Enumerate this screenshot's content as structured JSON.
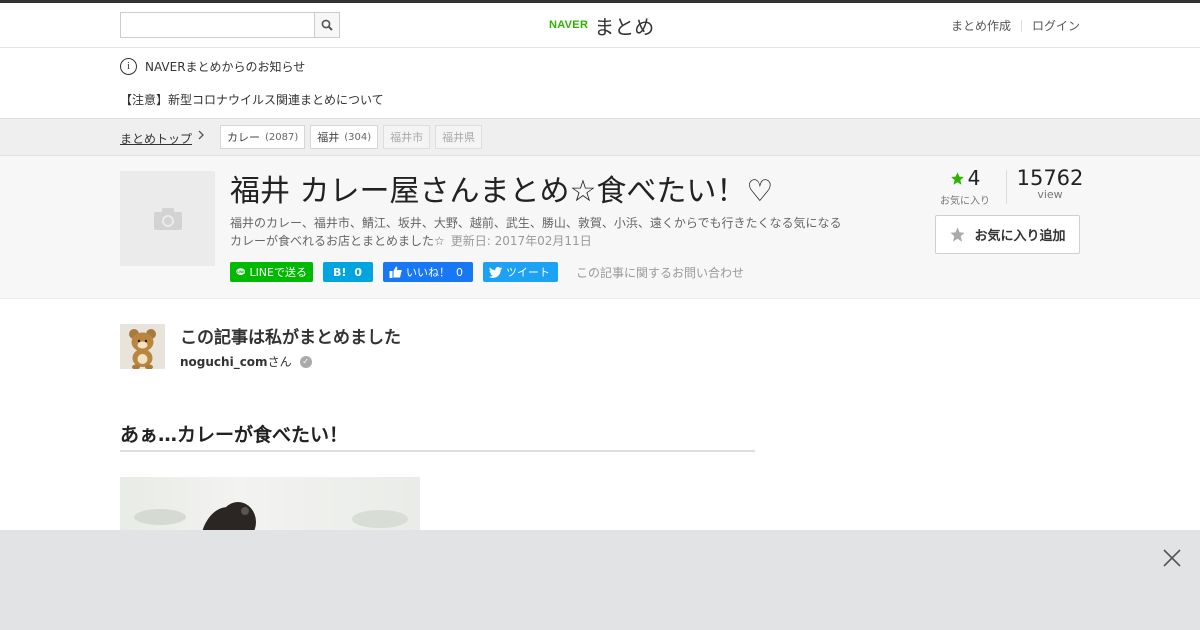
{
  "header": {
    "search_placeholder": "",
    "search_icon": "search-icon",
    "logo_naver": "NAVER",
    "logo_matome": "まとめ",
    "links": [
      "まとめ作成",
      "ログイン"
    ]
  },
  "notices": {
    "info_icon": "info-icon",
    "title": "NAVERまとめからのお知らせ",
    "item": "【注意】新型コロナウイルス関連まとめについて"
  },
  "breadcrumb": {
    "home": "まとめトップ",
    "tags": [
      {
        "label": "カレー",
        "count": "(2087)"
      },
      {
        "label": "福井",
        "count": "(304)"
      },
      {
        "label": "福井市",
        "count": ""
      },
      {
        "label": "福井県",
        "count": ""
      }
    ]
  },
  "article": {
    "title": "福井 カレー屋さんまとめ☆食べたい！♡",
    "description": "福井のカレー、福井市、鯖江、坂井、大野、越前、武生、勝山、敦賀、小浜、遠くからでも行きたくなる気になるカレーが食べれるお店とまとめました☆",
    "updated": "更新日: 2017年02月11日",
    "thumb_icon": "camera-icon",
    "share": {
      "line": "LINEで送る",
      "hatena_label": "B!",
      "hatena_count": "0",
      "facebook": "いいね！",
      "facebook_count": "0",
      "twitter": "ツイート",
      "contact": "この記事に関するお問い合わせ"
    },
    "favorites": "4",
    "favorites_label": "お気に入り",
    "views": "15762",
    "views_label": "view",
    "fav_button": "お気に入り追加"
  },
  "author": {
    "heading": "この記事は私がまとめました",
    "name": "noguchi_com",
    "suffix": "さん",
    "verified_icon": "verified-check-icon"
  },
  "section": {
    "heading": "あぁ…カレーが食べたい！"
  },
  "colors": {
    "accent_green": "#2db400",
    "line": "#00b900",
    "hatena": "#00a4de",
    "facebook": "#1877f2",
    "twitter": "#1da1f2"
  }
}
